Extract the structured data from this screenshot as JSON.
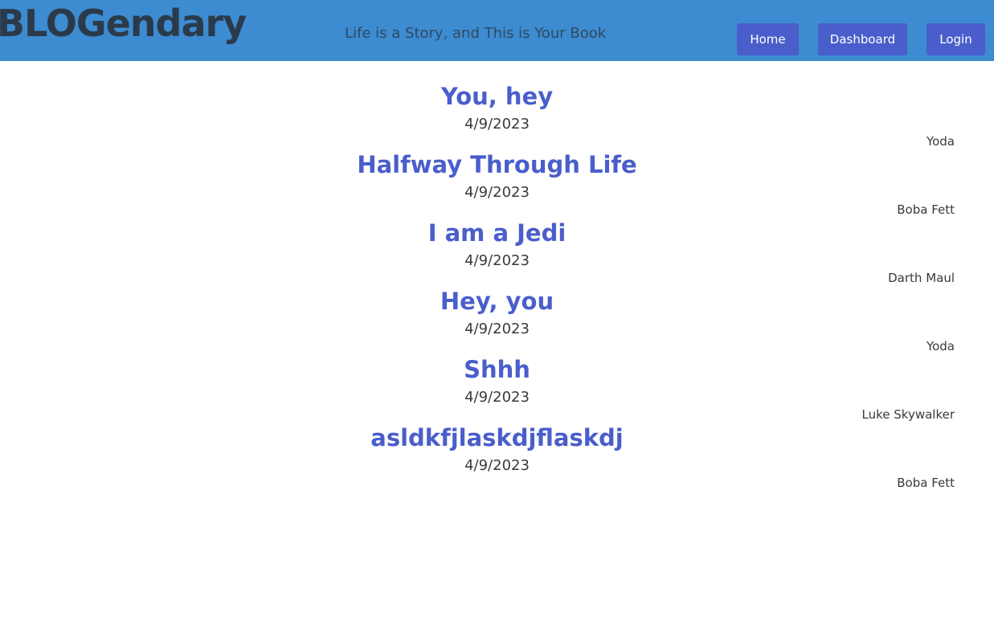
{
  "header": {
    "brand": "BLOGendary",
    "tagline": "Life is a Story, and This is Your Book",
    "nav": {
      "home_label": "Home",
      "dashboard_label": "Dashboard",
      "login_label": "Login"
    }
  },
  "posts": [
    {
      "title": "You, hey",
      "date": "4/9/2023",
      "author": "Yoda"
    },
    {
      "title": "Halfway Through Life",
      "date": "4/9/2023",
      "author": "Boba Fett"
    },
    {
      "title": "I am a Jedi",
      "date": "4/9/2023",
      "author": "Darth Maul"
    },
    {
      "title": "Hey, you",
      "date": "4/9/2023",
      "author": "Yoda"
    },
    {
      "title": "Shhh",
      "date": "4/9/2023",
      "author": "Luke Skywalker"
    },
    {
      "title": "asldkfjlaskdjflaskdj",
      "date": "4/9/2023",
      "author": "Boba Fett"
    }
  ],
  "colors": {
    "header_bg": "#3d8bd0",
    "button_bg": "#4a5ecb",
    "title_color": "#4a5ecb"
  }
}
